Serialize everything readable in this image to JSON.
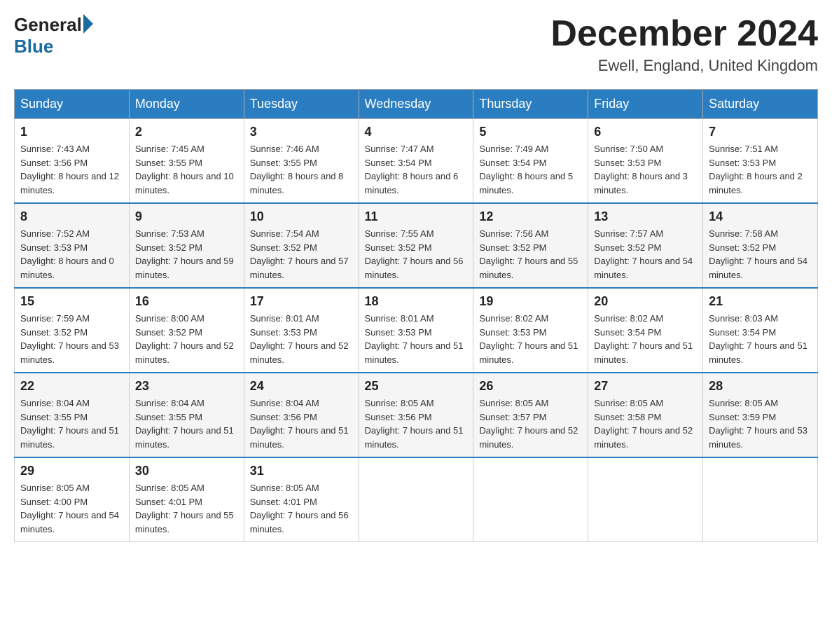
{
  "header": {
    "logo_general": "General",
    "logo_blue": "Blue",
    "month_title": "December 2024",
    "location": "Ewell, England, United Kingdom"
  },
  "days_of_week": [
    "Sunday",
    "Monday",
    "Tuesday",
    "Wednesday",
    "Thursday",
    "Friday",
    "Saturday"
  ],
  "weeks": [
    [
      {
        "day": "1",
        "sunrise": "7:43 AM",
        "sunset": "3:56 PM",
        "daylight": "8 hours and 12 minutes."
      },
      {
        "day": "2",
        "sunrise": "7:45 AM",
        "sunset": "3:55 PM",
        "daylight": "8 hours and 10 minutes."
      },
      {
        "day": "3",
        "sunrise": "7:46 AM",
        "sunset": "3:55 PM",
        "daylight": "8 hours and 8 minutes."
      },
      {
        "day": "4",
        "sunrise": "7:47 AM",
        "sunset": "3:54 PM",
        "daylight": "8 hours and 6 minutes."
      },
      {
        "day": "5",
        "sunrise": "7:49 AM",
        "sunset": "3:54 PM",
        "daylight": "8 hours and 5 minutes."
      },
      {
        "day": "6",
        "sunrise": "7:50 AM",
        "sunset": "3:53 PM",
        "daylight": "8 hours and 3 minutes."
      },
      {
        "day": "7",
        "sunrise": "7:51 AM",
        "sunset": "3:53 PM",
        "daylight": "8 hours and 2 minutes."
      }
    ],
    [
      {
        "day": "8",
        "sunrise": "7:52 AM",
        "sunset": "3:53 PM",
        "daylight": "8 hours and 0 minutes."
      },
      {
        "day": "9",
        "sunrise": "7:53 AM",
        "sunset": "3:52 PM",
        "daylight": "7 hours and 59 minutes."
      },
      {
        "day": "10",
        "sunrise": "7:54 AM",
        "sunset": "3:52 PM",
        "daylight": "7 hours and 57 minutes."
      },
      {
        "day": "11",
        "sunrise": "7:55 AM",
        "sunset": "3:52 PM",
        "daylight": "7 hours and 56 minutes."
      },
      {
        "day": "12",
        "sunrise": "7:56 AM",
        "sunset": "3:52 PM",
        "daylight": "7 hours and 55 minutes."
      },
      {
        "day": "13",
        "sunrise": "7:57 AM",
        "sunset": "3:52 PM",
        "daylight": "7 hours and 54 minutes."
      },
      {
        "day": "14",
        "sunrise": "7:58 AM",
        "sunset": "3:52 PM",
        "daylight": "7 hours and 54 minutes."
      }
    ],
    [
      {
        "day": "15",
        "sunrise": "7:59 AM",
        "sunset": "3:52 PM",
        "daylight": "7 hours and 53 minutes."
      },
      {
        "day": "16",
        "sunrise": "8:00 AM",
        "sunset": "3:52 PM",
        "daylight": "7 hours and 52 minutes."
      },
      {
        "day": "17",
        "sunrise": "8:01 AM",
        "sunset": "3:53 PM",
        "daylight": "7 hours and 52 minutes."
      },
      {
        "day": "18",
        "sunrise": "8:01 AM",
        "sunset": "3:53 PM",
        "daylight": "7 hours and 51 minutes."
      },
      {
        "day": "19",
        "sunrise": "8:02 AM",
        "sunset": "3:53 PM",
        "daylight": "7 hours and 51 minutes."
      },
      {
        "day": "20",
        "sunrise": "8:02 AM",
        "sunset": "3:54 PM",
        "daylight": "7 hours and 51 minutes."
      },
      {
        "day": "21",
        "sunrise": "8:03 AM",
        "sunset": "3:54 PM",
        "daylight": "7 hours and 51 minutes."
      }
    ],
    [
      {
        "day": "22",
        "sunrise": "8:04 AM",
        "sunset": "3:55 PM",
        "daylight": "7 hours and 51 minutes."
      },
      {
        "day": "23",
        "sunrise": "8:04 AM",
        "sunset": "3:55 PM",
        "daylight": "7 hours and 51 minutes."
      },
      {
        "day": "24",
        "sunrise": "8:04 AM",
        "sunset": "3:56 PM",
        "daylight": "7 hours and 51 minutes."
      },
      {
        "day": "25",
        "sunrise": "8:05 AM",
        "sunset": "3:56 PM",
        "daylight": "7 hours and 51 minutes."
      },
      {
        "day": "26",
        "sunrise": "8:05 AM",
        "sunset": "3:57 PM",
        "daylight": "7 hours and 52 minutes."
      },
      {
        "day": "27",
        "sunrise": "8:05 AM",
        "sunset": "3:58 PM",
        "daylight": "7 hours and 52 minutes."
      },
      {
        "day": "28",
        "sunrise": "8:05 AM",
        "sunset": "3:59 PM",
        "daylight": "7 hours and 53 minutes."
      }
    ],
    [
      {
        "day": "29",
        "sunrise": "8:05 AM",
        "sunset": "4:00 PM",
        "daylight": "7 hours and 54 minutes."
      },
      {
        "day": "30",
        "sunrise": "8:05 AM",
        "sunset": "4:01 PM",
        "daylight": "7 hours and 55 minutes."
      },
      {
        "day": "31",
        "sunrise": "8:05 AM",
        "sunset": "4:01 PM",
        "daylight": "7 hours and 56 minutes."
      },
      null,
      null,
      null,
      null
    ]
  ]
}
